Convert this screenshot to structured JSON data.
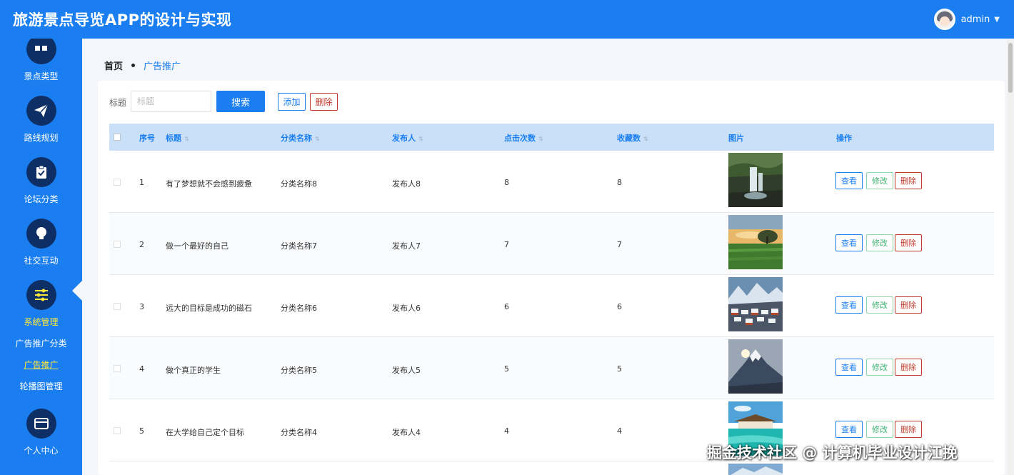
{
  "app": {
    "title": "旅游景点导览APP的设计与实现"
  },
  "user": {
    "name": "admin",
    "caret": "▼"
  },
  "sidebar": {
    "items": [
      {
        "label": "景点类型",
        "icon": "grid-icon"
      },
      {
        "label": "路线规划",
        "icon": "paper-plane-icon"
      },
      {
        "label": "论坛分类",
        "icon": "clipboard-check-icon"
      },
      {
        "label": "社交互动",
        "icon": "lightbulb-icon"
      },
      {
        "label": "系统管理",
        "icon": "sliders-icon",
        "active": true
      },
      {
        "label": "个人中心",
        "icon": "card-icon"
      }
    ],
    "submenu": [
      {
        "label": "广告推广分类"
      },
      {
        "label": "广告推广",
        "active": true
      },
      {
        "label": "轮播图管理"
      }
    ]
  },
  "breadcrumb": {
    "home": "首页",
    "current": "广告推广"
  },
  "filter": {
    "label": "标题",
    "placeholder": "标题",
    "search_label": "搜索",
    "add_label": "添加",
    "delete_label": "删除"
  },
  "table": {
    "headers": {
      "index": "序号",
      "title": "标题",
      "category": "分类名称",
      "publisher": "发布人",
      "clicks": "点击次数",
      "favorites": "收藏数",
      "image": "图片",
      "actions": "操作"
    },
    "action_labels": {
      "view": "查看",
      "edit": "修改",
      "delete": "删除"
    },
    "rows": [
      {
        "index": "1",
        "title": "有了梦想就不会感到疲惫",
        "category": "分类名称8",
        "publisher": "发布人8",
        "clicks": "8",
        "favorites": "8",
        "image": "waterfall-image"
      },
      {
        "index": "2",
        "title": "做一个最好的自己",
        "category": "分类名称7",
        "publisher": "发布人7",
        "clicks": "7",
        "favorites": "7",
        "image": "sunset-field-image"
      },
      {
        "index": "3",
        "title": "远大的目标是成功的磁石",
        "category": "分类名称6",
        "publisher": "发布人6",
        "clicks": "6",
        "favorites": "6",
        "image": "mountain-village-image"
      },
      {
        "index": "4",
        "title": "做个真正的学生",
        "category": "分类名称5",
        "publisher": "发布人5",
        "clicks": "5",
        "favorites": "5",
        "image": "snow-mountain-image"
      },
      {
        "index": "5",
        "title": "在大学给自己定个目标",
        "category": "分类名称4",
        "publisher": "发布人4",
        "clicks": "4",
        "favorites": "4",
        "image": "tropical-lagoon-image"
      }
    ]
  },
  "watermark": "掘金技术社区 @ 计算机毕业设计江挽",
  "colors": {
    "primary": "#1a7ef0",
    "sidebar_icon_bg": "#0d2f66",
    "active_text": "#ffe83a",
    "danger": "#c0392b",
    "edit": "#3cb371",
    "table_header_bg": "#c9e0f8"
  }
}
